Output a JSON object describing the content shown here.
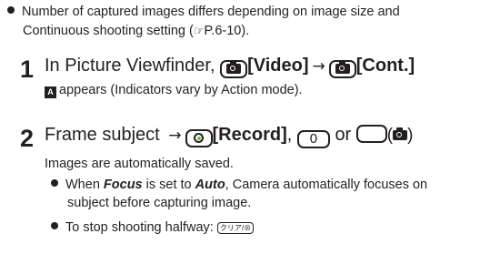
{
  "note": {
    "line1": "Number of captured images differs depending on image size and",
    "line2_before": "Continuous shooting setting (",
    "ref_icon": "☞",
    "ref_page": "P.6-10",
    "line2_after": ")."
  },
  "step1": {
    "number": "1",
    "text_start": "In Picture Viewfinder, ",
    "key1_label": "[Video]",
    "arrow": "→",
    "key2_label": "[Cont.]",
    "sub_text": "appears (Indicators vary by Action mode)."
  },
  "step2": {
    "number": "2",
    "text_start": "Frame subject ",
    "arrow": "→",
    "record_label": "[Record]",
    "comma": ",",
    "zero_key": "0",
    "or": "or",
    "paren_open": "(",
    "paren_close": ")",
    "sub_text": "Images are automatically saved.",
    "bullet1_before": "When ",
    "bullet1_focus": "Focus",
    "bullet1_mid": " is set to ",
    "bullet1_auto": "Auto",
    "bullet1_after": ", Camera automatically focuses on",
    "bullet1_line2": "subject before capturing image.",
    "bullet2_text": "To stop shooting halfway: ",
    "clear_key": "クリア/⊗"
  },
  "colors": {
    "text": "#231f20",
    "record_green": "#6cbf43"
  },
  "icons": [
    "bullet-dot",
    "reference-page-icon",
    "camera-key-icon",
    "record-key-icon",
    "zero-key",
    "blank-key",
    "cont-shooting-indicator-icon",
    "clear-key-icon"
  ]
}
